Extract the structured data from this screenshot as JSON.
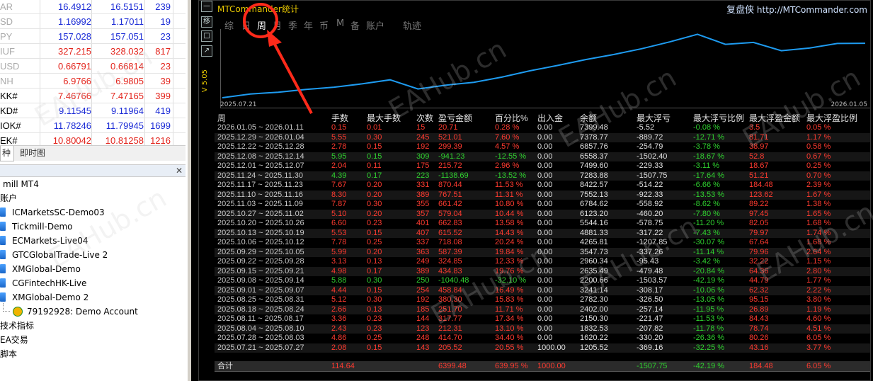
{
  "quotes": [
    {
      "sym": "AR",
      "bid": "16.4912",
      "ask": "16.5151",
      "spread": "239",
      "color": "blue"
    },
    {
      "sym": "SD",
      "bid": "1.16992",
      "ask": "1.17011",
      "spread": "19",
      "color": "blue"
    },
    {
      "sym": "PY",
      "bid": "157.028",
      "ask": "157.051",
      "spread": "23",
      "color": "blue"
    },
    {
      "sym": "IUF",
      "bid": "327.215",
      "ask": "328.032",
      "spread": "817",
      "color": "red"
    },
    {
      "sym": "USD",
      "bid": "0.66791",
      "ask": "0.66814",
      "spread": "23",
      "color": "red"
    },
    {
      "sym": "NH",
      "bid": "6.9766",
      "ask": "6.9805",
      "spread": "39",
      "color": "red"
    },
    {
      "sym": "KK#",
      "bid": "7.46766",
      "ask": "7.47165",
      "spread": "399",
      "color": "red"
    },
    {
      "sym": "KD#",
      "bid": "9.11545",
      "ask": "9.11964",
      "spread": "419",
      "color": "blue"
    },
    {
      "sym": "IOK#",
      "bid": "11.78246",
      "ask": "11.79945",
      "spread": "1699",
      "color": "blue"
    },
    {
      "sym": "EK#",
      "bid": "10.80042",
      "ask": "10.81258",
      "spread": "1216",
      "color": "red"
    }
  ],
  "quote_tabs": [
    "种",
    "即时图"
  ],
  "navigator": {
    "root": "mill MT4",
    "accounts_label": "账户",
    "accounts": [
      "ICMarketsSC-Demo03",
      "Tickmill-Demo",
      "ECMarkets-Live04",
      "GTCGlobalTrade-Live 2",
      "XMGlobal-Demo",
      "CGFintechHK-Live",
      "XMGlobal-Demo 2"
    ],
    "demo_account": "79192928: Demo Account",
    "sections": [
      "技术指标",
      "EA交易",
      "脚本"
    ]
  },
  "mtc": {
    "title": "MTCommander统计",
    "brand_cn": "复盘侠",
    "brand_url": "http://MTCommander.com",
    "version": "V 5.05",
    "side_buttons": [
      "—",
      "移",
      "□",
      "↗"
    ],
    "period_tabs": [
      "综",
      "日",
      "周",
      "月",
      "季",
      "年",
      "币",
      "M",
      "备",
      "账户",
      "轨迹"
    ],
    "active_tab": "周",
    "x_start": "2025.07.21",
    "x_end": "2026.01.05",
    "headers": [
      "周",
      "手数",
      "最大手数",
      "次数",
      "盈亏金额",
      "百分比%",
      "出入金",
      "余额",
      "最大浮亏",
      "最大浮亏比例",
      "最大浮盈金额",
      "最大浮盈比例"
    ],
    "rows": [
      [
        "2026.01.05 ~ 2026.01.11",
        "0.15",
        "0.01",
        "15",
        "20.71",
        "0.28 %",
        "0.00",
        "7399.48",
        "-5.52",
        "-0.08 %",
        "3.5",
        "0.05 %"
      ],
      [
        "2025.12.29 ~ 2026.01.04",
        "5.55",
        "0.30",
        "245",
        "521.01",
        "7.60 %",
        "0.00",
        "7378.77",
        "-889.72",
        "-12.71 %",
        "81.71",
        "1.17 %"
      ],
      [
        "2025.12.22 ~ 2025.12.28",
        "2.78",
        "0.15",
        "192",
        "299.39",
        "4.57 %",
        "0.00",
        "6857.76",
        "-254.79",
        "-3.78 %",
        "38.97",
        "0.58 %"
      ],
      [
        "2025.12.08 ~ 2025.12.14",
        "5.95",
        "0.15",
        "309",
        "-941.23",
        "-12.55 %",
        "0.00",
        "6558.37",
        "-1502.40",
        "-18.67 %",
        "52.8",
        "0.67 %"
      ],
      [
        "2025.12.01 ~ 2025.12.07",
        "2.04",
        "0.11",
        "175",
        "215.72",
        "2.96 %",
        "0.00",
        "7499.60",
        "-229.33",
        "-3.11 %",
        "18.67",
        "0.25 %"
      ],
      [
        "2025.11.24 ~ 2025.11.30",
        "4.39",
        "0.17",
        "223",
        "-1138.69",
        "-13.52 %",
        "0.00",
        "7283.88",
        "-1507.75",
        "-17.64 %",
        "51.21",
        "0.70 %"
      ],
      [
        "2025.11.17 ~ 2025.11.23",
        "7.67",
        "0.20",
        "331",
        "870.44",
        "11.53 %",
        "0.00",
        "8422.57",
        "-514.22",
        "-6.66 %",
        "184.48",
        "2.39 %"
      ],
      [
        "2025.11.10 ~ 2025.11.16",
        "8.30",
        "0.20",
        "389",
        "767.51",
        "11.31 %",
        "0.00",
        "7552.13",
        "-922.33",
        "-13.53 %",
        "123.62",
        "1.67 %"
      ],
      [
        "2025.11.03 ~ 2025.11.09",
        "7.87",
        "0.30",
        "355",
        "661.42",
        "10.80 %",
        "0.00",
        "6784.62",
        "-558.92",
        "-8.62 %",
        "89.22",
        "1.38 %"
      ],
      [
        "2025.10.27 ~ 2025.11.02",
        "5.10",
        "0.20",
        "357",
        "579.04",
        "10.44 %",
        "0.00",
        "6123.20",
        "-460.20",
        "-7.80 %",
        "97.45",
        "1.65 %"
      ],
      [
        "2025.10.20 ~ 2025.10.26",
        "6.60",
        "0.23",
        "401",
        "662.83",
        "13.58 %",
        "0.00",
        "5544.16",
        "-578.75",
        "-11.20 %",
        "82.05",
        "1.68 %"
      ],
      [
        "2025.10.13 ~ 2025.10.19",
        "5.53",
        "0.15",
        "407",
        "615.52",
        "14.43 %",
        "0.00",
        "4881.33",
        "-317.22",
        "-7.43 %",
        "79.97",
        "1.74 %"
      ],
      [
        "2025.10.06 ~ 2025.10.12",
        "7.78",
        "0.25",
        "337",
        "718.08",
        "20.24 %",
        "0.00",
        "4265.81",
        "-1207.85",
        "-30.07 %",
        "67.64",
        "1.68 %"
      ],
      [
        "2025.09.29 ~ 2025.10.05",
        "5.99",
        "0.20",
        "363",
        "587.39",
        "19.84 %",
        "0.00",
        "3547.73",
        "-337.26",
        "-11.14 %",
        "79.96",
        "2.64 %"
      ],
      [
        "2025.09.22 ~ 2025.09.28",
        "3.13",
        "0.13",
        "249",
        "324.85",
        "12.33 %",
        "0.00",
        "2960.34",
        "-95.43",
        "-3.42 %",
        "32.22",
        "1.15 %"
      ],
      [
        "2025.09.15 ~ 2025.09.21",
        "4.98",
        "0.17",
        "389",
        "434.83",
        "19.76 %",
        "0.00",
        "2635.49",
        "-479.48",
        "-20.84 %",
        "64.36",
        "2.80 %"
      ],
      [
        "2025.09.08 ~ 2025.09.14",
        "5.88",
        "0.30",
        "250",
        "-1040.48",
        "-32.10 %",
        "0.00",
        "2200.66",
        "-1503.57",
        "-42.19 %",
        "44.79",
        "1.77 %"
      ],
      [
        "2025.09.01 ~ 2025.09.07",
        "4.44",
        "0.15",
        "254",
        "458.84",
        "16.49 %",
        "0.00",
        "3241.14",
        "-308.17",
        "-10.06 %",
        "62.32",
        "2.22 %"
      ],
      [
        "2025.08.25 ~ 2025.08.31",
        "5.12",
        "0.30",
        "192",
        "380.30",
        "15.83 %",
        "0.00",
        "2782.30",
        "-326.50",
        "-13.05 %",
        "95.15",
        "3.80 %"
      ],
      [
        "2025.08.18 ~ 2025.08.24",
        "2.66",
        "0.13",
        "185",
        "251.70",
        "11.71 %",
        "0.00",
        "2402.00",
        "-257.14",
        "-11.95 %",
        "26.89",
        "1.19 %"
      ],
      [
        "2025.08.11 ~ 2025.08.17",
        "3.36",
        "0.23",
        "144",
        "317.77",
        "17.34 %",
        "0.00",
        "2150.30",
        "-221.47",
        "-11.53 %",
        "84.43",
        "4.60 %"
      ],
      [
        "2025.08.04 ~ 2025.08.10",
        "2.43",
        "0.23",
        "123",
        "212.31",
        "13.10 %",
        "0.00",
        "1832.53",
        "-207.82",
        "-11.78 %",
        "78.74",
        "4.51 %"
      ],
      [
        "2025.07.28 ~ 2025.08.03",
        "4.86",
        "0.25",
        "248",
        "414.70",
        "34.40 %",
        "0.00",
        "1620.22",
        "-330.20",
        "-26.36 %",
        "80.26",
        "6.05 %"
      ],
      [
        "2025.07.21 ~ 2025.07.27",
        "2.08",
        "0.15",
        "143",
        "205.52",
        "20.55 %",
        "1000.00",
        "1205.52",
        "-369.16",
        "-32.25 %",
        "43.16",
        "3.77 %"
      ]
    ],
    "total": [
      "合计",
      "114.64",
      "",
      "",
      "6399.48",
      "639.95 %",
      "1000.00",
      "",
      "-1507.75",
      "-42.19 %",
      "184.48",
      "6.05 %"
    ],
    "watermark": "EAHub.cn"
  },
  "colors": {
    "accent_yellow": "#e8c800",
    "line_blue": "#1e9bf0",
    "profit_red": "#ff3b30",
    "loss_green": "#2fd12f"
  }
}
